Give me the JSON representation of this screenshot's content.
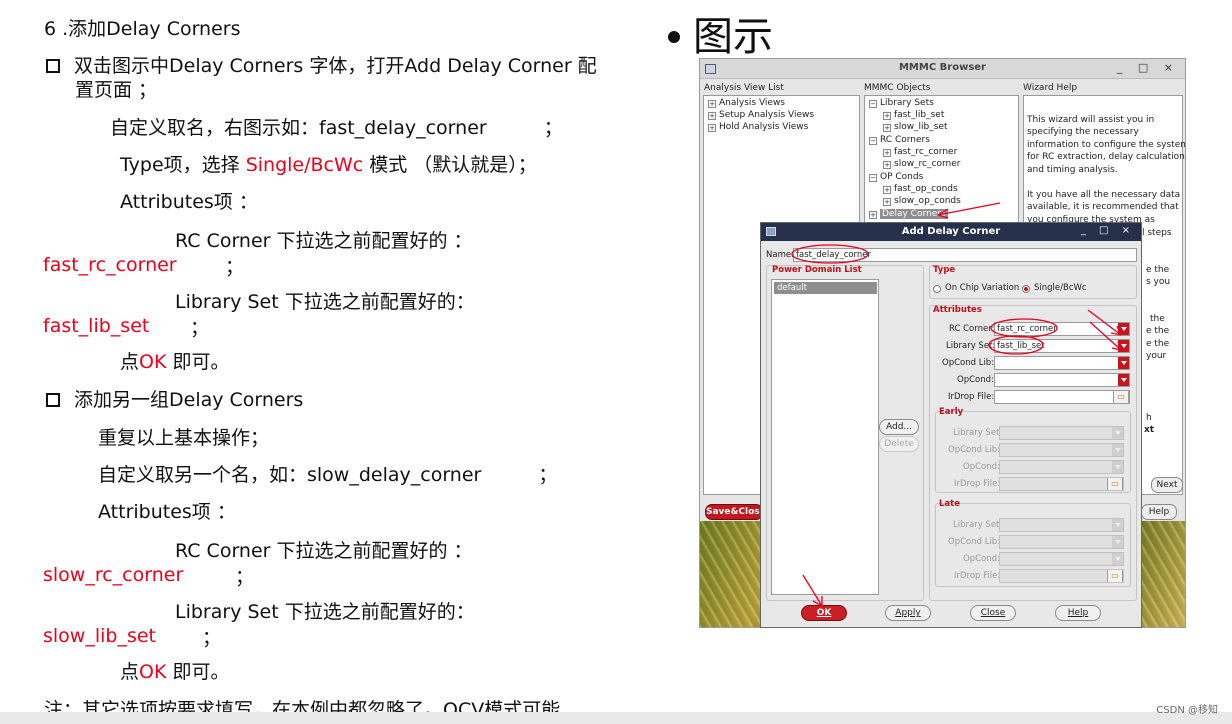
{
  "doc": {
    "step_heading": "6 .添加Delay Corners",
    "bullet1_line1": "双击图示中Delay Corners 字体，打开Add Delay Corner 配",
    "bullet1_line2": "置页面 ；",
    "name_line": "自定义取名，右图示如：fast_delay_corner　　　；",
    "type_prefix": "Type项，选择 ",
    "type_value": "Single/BcWc",
    "type_suffix": " 模式 （默认就是）；",
    "attributes_a": "Attributes项 ：",
    "rc_corner_a": "RC Corner 下拉选之前配置好的 ：",
    "rc_value_a": "fast_rc_corner",
    "rc_semicolon_a": "；",
    "libset_a": "Library Set 下拉选之前配置好的：",
    "lib_value_a": "fast_lib_set",
    "lib_semicolon_a": "；",
    "ok_prefix_a": "点",
    "ok_word_a": "OK",
    "ok_suffix_a": " 即可。",
    "bullet2": "添加另一组Delay Corners",
    "repeat_line": "重复以上基本操作；",
    "name_line_b": "自定义取另一个名，如：slow_delay_corner　　　；",
    "attributes_b": "Attributes项 ：",
    "rc_corner_b": "RC Corner 下拉选之前配置好的 ：",
    "rc_value_b": "slow_rc_corner",
    "rc_semicolon_b": "；",
    "libset_b": "Library Set 下拉选之前配置好的：",
    "lib_value_b": "slow_lib_set",
    "lib_semicolon_b": "；",
    "ok_prefix_b": "点",
    "ok_word_b": "OK",
    "ok_suffix_b": " 即可。",
    "note_line": "注：其它选项按要求填写，在本例中都忽略了。OCV模式可能"
  },
  "figure": {
    "heading": "图示",
    "browser": {
      "title": "MMMC Browser",
      "controls": "_ □ ×",
      "pane_headers": [
        "Analysis View List",
        "MMMC Objects",
        "Wizard Help"
      ],
      "analysis_tree": [
        "Analysis Views",
        "Setup Analysis Views",
        "Hold Analysis Views"
      ],
      "objects_tree": [
        "Library Sets",
        "fast_lib_set",
        "slow_lib_set",
        "RC Corners",
        "fast_rc_corner",
        "slow_rc_corner",
        "OP Conds",
        "fast_op_conds",
        "slow_op_conds",
        "Delay Corners"
      ],
      "wizard_text": [
        "This wizard will assist you in",
        "specifying the necessary",
        "information to configure the system",
        "for RC extraction, delay calculation,",
        "and timing analysis.",
        "",
        "It you have all the necessary data",
        "available, it is recommended that",
        "you configure the system as"
      ],
      "wizard_right_fragments": [
        "l steps",
        "e the",
        "s you",
        "the",
        "e the",
        "e the",
        "your",
        "h",
        "xt"
      ],
      "next_label": "Next",
      "save_close_label": "Save&Close...",
      "help_label": "Help"
    },
    "dialog": {
      "title": "Add Delay Corner",
      "controls": "_ □ ×",
      "name_label": "Name:",
      "name_value": "fast_delay_corner",
      "power_domain_header": "Power Domain List",
      "power_domain_items": [
        "default"
      ],
      "add_label": "Add...",
      "delete_label": "Delete",
      "type_header": "Type",
      "type_options": [
        "On Chip Variation",
        "Single/BcWc"
      ],
      "type_selected": "Single/BcWc",
      "attributes_header": "Attributes",
      "rc_corner_label": "RC Corner:",
      "rc_corner_value": "fast_rc_corner",
      "library_set_label": "Library Set:",
      "library_set_value": "fast_lib_set",
      "opcond_lib_label": "OpCond Lib:",
      "opcond_label": "OpCond:",
      "irdrop_label": "IrDrop File:",
      "early_header": "Early",
      "late_header": "Late",
      "early_labels": [
        "Library Set:",
        "OpCond Lib:",
        "OpCond:",
        "IrDrop File:"
      ],
      "late_labels": [
        "Library Set:",
        "OpCond Lib:",
        "OpCond:",
        "IrDrop File:"
      ],
      "ok_label": "OK",
      "apply_label": "Apply",
      "close_label": "Close",
      "help_label": "Help"
    }
  },
  "watermark": "CSDN @移知",
  "colors": {
    "highlight_red": "#e8001c",
    "dialog_title_bar": "#26304a",
    "dropdown_red": "#c4161e"
  }
}
